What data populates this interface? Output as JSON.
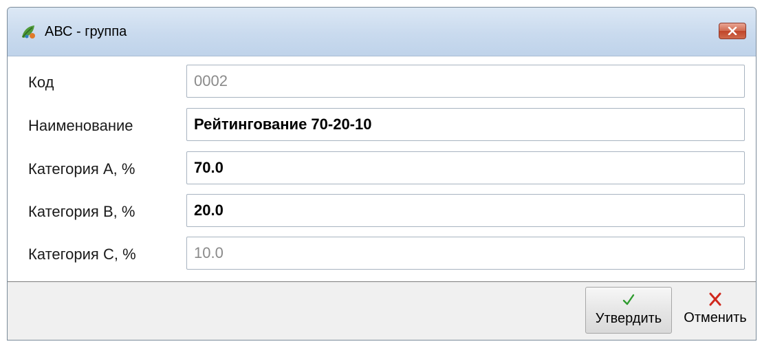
{
  "window": {
    "title": "АВС - группа",
    "close_label": "✕"
  },
  "form": {
    "rows": [
      {
        "label": "Код",
        "value": "0002",
        "readonly": true
      },
      {
        "label": "Наименование",
        "value": "Рейтингование 70-20-10",
        "readonly": false
      },
      {
        "label": "Категория А, %",
        "value": "70.0",
        "readonly": false
      },
      {
        "label": "Категория В, %",
        "value": "20.0",
        "readonly": false
      },
      {
        "label": "Категория С, %",
        "value": "10.0",
        "readonly": true
      }
    ]
  },
  "footer": {
    "confirm_label": "Утвердить",
    "cancel_label": "Отменить"
  },
  "colors": {
    "confirm_icon": "#2e9b2e",
    "cancel_icon": "#d0281d",
    "readonly_text": "#8a8a8a"
  },
  "icons": {
    "app": "app-leaf-icon",
    "close": "close-icon",
    "confirm": "checkmark-icon",
    "cancel": "cross-icon"
  }
}
